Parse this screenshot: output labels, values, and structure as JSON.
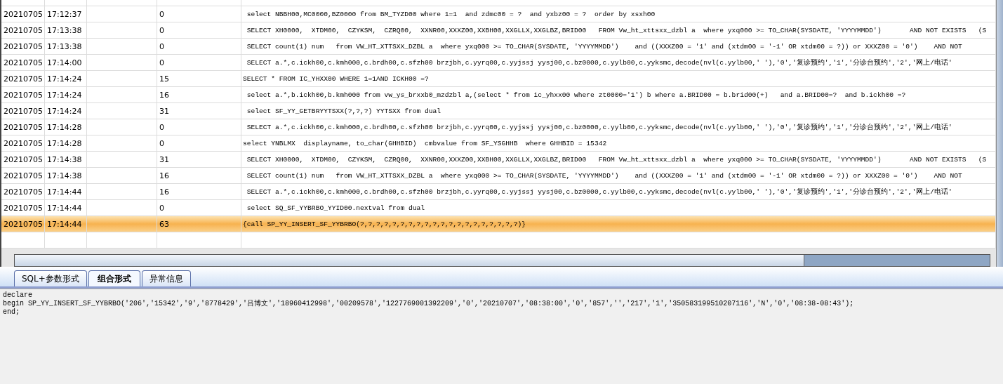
{
  "log_table": {
    "rows": [
      {
        "date": "20210705",
        "time": "17:12:37",
        "duration": "0",
        "sql": " select NBBH00,MC0000,BZ0000 from BM_TYZD00 where 1=1  and zdmc00 = ?  and yxbz00 = ?  order by xsxh00",
        "selected": false
      },
      {
        "date": "20210705",
        "time": "17:13:38",
        "duration": "0",
        "sql": " SELECT XH0000,  XTDM00,  CZYKSM,  CZRQ00,  XXNR00,XXXZ00,XXBH00,XXGLLX,XXGLBZ,BRID00   FROM Vw_ht_xttsxx_dzbl a  where yxq000 >= TO_CHAR(SYSDATE, 'YYYYMMDD')       AND NOT EXISTS   (S",
        "selected": false
      },
      {
        "date": "20210705",
        "time": "17:13:38",
        "duration": "0",
        "sql": " SELECT count(1) num   from VW_HT_XTTSXX_DZBL a  where yxq000 >= TO_CHAR(SYSDATE, 'YYYYMMDD')    and ((XXXZ00 = '1' and (xtdm00 = '-1' OR xtdm00 = ?)) or XXXZ00 = '0')    AND NOT",
        "selected": false
      },
      {
        "date": "20210705",
        "time": "17:14:00",
        "duration": "0",
        "sql": " SELECT a.*,c.ickh00,c.kmh000,c.brdh00,c.sfzh00 brzjbh,c.yyrq00,c.yyjssj yysj00,c.bz0000,c.yylb00,c.yyksmc,decode(nvl(c.yylb00,' '),'0','复诊预约','1','分诊台预约','2','网上/电话'",
        "selected": false
      },
      {
        "date": "20210705",
        "time": "17:14:24",
        "duration": "15",
        "sql": "SELECT * FROM IC_YHXX00 WHERE 1=1AND ICKH00 =?",
        "selected": false
      },
      {
        "date": "20210705",
        "time": "17:14:24",
        "duration": "16",
        "sql": " select a.*,b.ickh00,b.kmh000 from vw_ys_brxxb0_mzdzbl a,(select * from ic_yhxx00 where zt0000='1') b where a.BRID00 = b.brid00(+)   and a.BRID00=?  and b.ickh00 =?",
        "selected": false
      },
      {
        "date": "20210705",
        "time": "17:14:24",
        "duration": "31",
        "sql": " select SF_YY_GETBRYYTSXX(?,?,?) YYTSXX from dual",
        "selected": false
      },
      {
        "date": "20210705",
        "time": "17:14:28",
        "duration": "0",
        "sql": " SELECT a.*,c.ickh00,c.kmh000,c.brdh00,c.sfzh00 brzjbh,c.yyrq00,c.yyjssj yysj00,c.bz0000,c.yylb00,c.yyksmc,decode(nvl(c.yylb00,' '),'0','复诊预约','1','分诊台预约','2','网上/电话'",
        "selected": false
      },
      {
        "date": "20210705",
        "time": "17:14:28",
        "duration": "0",
        "sql": "select YNBLMX  displayname, to_char(GHHBID)  cmbvalue from SF_YSGHHB  where GHHBID = 15342",
        "selected": false
      },
      {
        "date": "20210705",
        "time": "17:14:38",
        "duration": "31",
        "sql": " SELECT XH0000,  XTDM00,  CZYKSM,  CZRQ00,  XXNR00,XXXZ00,XXBH00,XXGLLX,XXGLBZ,BRID00   FROM Vw_ht_xttsxx_dzbl a  where yxq000 >= TO_CHAR(SYSDATE, 'YYYYMMDD')       AND NOT EXISTS   (S",
        "selected": false
      },
      {
        "date": "20210705",
        "time": "17:14:38",
        "duration": "16",
        "sql": " SELECT count(1) num   from VW_HT_XTTSXX_DZBL a  where yxq000 >= TO_CHAR(SYSDATE, 'YYYYMMDD')    and ((XXXZ00 = '1' and (xtdm00 = '-1' OR xtdm00 = ?)) or XXXZ00 = '0')    AND NOT",
        "selected": false
      },
      {
        "date": "20210705",
        "time": "17:14:44",
        "duration": "16",
        "sql": " SELECT a.*,c.ickh00,c.kmh000,c.brdh00,c.sfzh00 brzjbh,c.yyrq00,c.yyjssj yysj00,c.bz0000,c.yylb00,c.yyksmc,decode(nvl(c.yylb00,' '),'0','复诊预约','1','分诊台预约','2','网上/电话'",
        "selected": false
      },
      {
        "date": "20210705",
        "time": "17:14:44",
        "duration": "0",
        "sql": " select SQ_SF_YYBRBO_YYID00.nextval from dual",
        "selected": false
      },
      {
        "date": "20210705",
        "time": "17:14:44",
        "duration": "63",
        "sql": "{call SP_YY_INSERT_SF_YYBRBO(?,?,?,?,?,?,?,?,?,?,?,?,?,?,?,?,?,?,?,?)}",
        "selected": true
      }
    ]
  },
  "tabs": [
    {
      "label": "SQL+参数形式",
      "selected": false
    },
    {
      "label": "组合形式",
      "selected": true
    },
    {
      "label": "异常信息",
      "selected": false
    }
  ],
  "output_lines": [
    "declare",
    "begin SP_YY_INSERT_SF_YYBRBO('206','15342','9','8778429','吕博文','18960412998','00209578','1227769001392209','0','20210707','08:38:00','0','857','','217','1','350583199510207116','N','0','08:38-08:43');",
    "end;"
  ]
}
